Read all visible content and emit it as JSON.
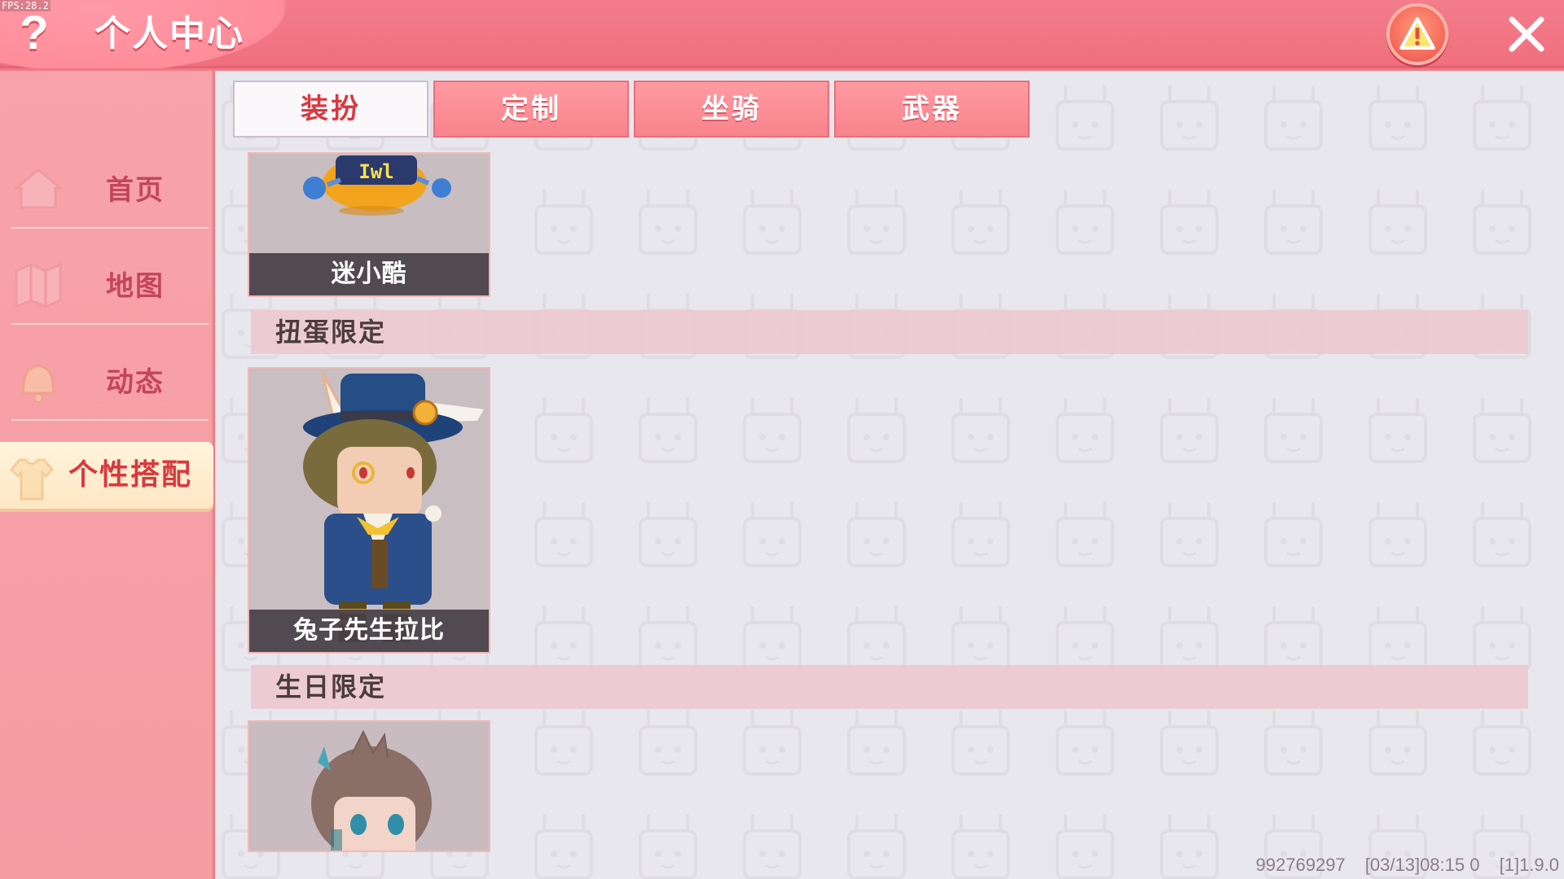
{
  "fps": "FPS:28.2",
  "header": {
    "title": "个人中心",
    "help_icon": "?",
    "warning_icon": "warning-icon",
    "close_icon": "close-icon",
    "accent": "#f07a86"
  },
  "sidebar": {
    "items": [
      {
        "label": "首页",
        "icon": "home-icon"
      },
      {
        "label": "地图",
        "icon": "map-icon"
      },
      {
        "label": "动态",
        "icon": "bell-icon"
      },
      {
        "label": "个性搭配",
        "icon": "shirt-icon",
        "active": true
      }
    ]
  },
  "tabs": [
    {
      "label": "装扮",
      "active": true
    },
    {
      "label": "定制"
    },
    {
      "label": "坐骑"
    },
    {
      "label": "武器"
    }
  ],
  "content": {
    "cards": [
      {
        "label": "迷小酷",
        "art": "robot-character"
      },
      {
        "label": "兔子先生拉比",
        "art": "rabbit-gentleman-character"
      },
      {
        "label": "",
        "art": "birthday-character"
      }
    ],
    "sections": [
      {
        "title": "扭蛋限定"
      },
      {
        "title": "生日限定"
      }
    ]
  },
  "footer": {
    "uid": "992769297",
    "timestamp": "[03/13]08:15 0",
    "version": "[1]1.9.0"
  }
}
